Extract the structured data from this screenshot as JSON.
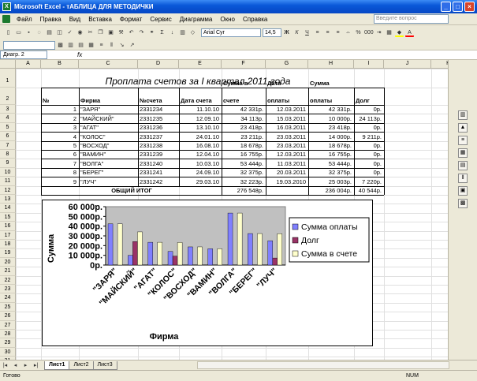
{
  "window": {
    "title": "Microsoft Excel - тАБЛИЦА ДЛЯ МЕТОДИЧКИ",
    "app_icon": "excel-icon"
  },
  "menu": {
    "items": [
      "Файл",
      "Правка",
      "Вид",
      "Вставка",
      "Формат",
      "Сервис",
      "Диаграмма",
      "Окно",
      "Справка"
    ],
    "help_placeholder": "Введите вопрос"
  },
  "toolbar": {
    "font": "Arial Cyr",
    "size": "14,5"
  },
  "namebox": "Диагр. 2",
  "fx": "fx",
  "columns": [
    "A",
    "B",
    "C",
    "D",
    "E",
    "F",
    "G",
    "H",
    "I",
    "J",
    "K"
  ],
  "rows": [
    "1",
    "2",
    "3",
    "4",
    "5",
    "6",
    "7",
    "8",
    "9",
    "10",
    "11",
    "12",
    "13",
    "14",
    "15",
    "16",
    "17",
    "18",
    "19",
    "20",
    "21",
    "22",
    "23",
    "24",
    "25",
    "26",
    "27",
    "28",
    "29",
    "30",
    "31"
  ],
  "sheet": {
    "title": "Проплата счетов за I квартал 2011 года",
    "headers": {
      "num": "№",
      "firm": "Фирма",
      "invoice": "№счета",
      "inv_date": "Дата счета",
      "sum_line1": "Сумма в",
      "sum_line2": "счете",
      "pay_line1": "Дата",
      "pay_line2": "оплаты",
      "paid_line1": "Сумма",
      "paid_line2": "оплаты",
      "debt": "Долг"
    },
    "data": [
      [
        "1",
        "\"ЗАРЯ\"",
        "2331234",
        "11.10.10",
        "42 331р.",
        "12.03.2011",
        "42 331р.",
        "0р."
      ],
      [
        "2",
        "\"МАЙСКИЙ\"",
        "2331235",
        "12.09.10",
        "34 113р.",
        "15.03.2011",
        "10 000р.",
        "24 113р."
      ],
      [
        "3",
        "\"АГАТ\"",
        "2331236",
        "13.10.10",
        "23 418р.",
        "16.03.2011",
        "23 418р.",
        "0р."
      ],
      [
        "4",
        "\"КОЛОС\"",
        "2331237",
        "24.01.10",
        "23 211р.",
        "23.03.2011",
        "14 000р.",
        "9 211р."
      ],
      [
        "5",
        "\"ВОСХОД\"",
        "2331238",
        "16.08.10",
        "18 678р.",
        "23.03.2011",
        "18 678р.",
        "0р."
      ],
      [
        "6",
        "\"ВАМИН\"",
        "2331239",
        "12.04.10",
        "16 755р.",
        "12.03.2011",
        "16 755р.",
        "0р."
      ],
      [
        "7",
        "\"ВОЛГА\"",
        "2331240",
        "10.03.10",
        "53 444р.",
        "11.03.2011",
        "53 444р.",
        "0р."
      ],
      [
        "8",
        "\"БЕРЕГ\"",
        "2331241",
        "24.09.10",
        "32 375р.",
        "20.03.2011",
        "32 375р.",
        "0р."
      ],
      [
        "9",
        "\"ЛУЧ\"",
        "2331242",
        "29.03.10",
        "32 223р.",
        "19.03.2010",
        "25 003р.",
        "7 220р."
      ]
    ],
    "total": {
      "label": "ОБЩИЙ ИТОГ",
      "sum": "276 548р.",
      "paid": "236 004р.",
      "debt": "40 544р."
    }
  },
  "chart_data": {
    "type": "bar",
    "categories": [
      "\"ЗАРЯ\"",
      "\"МАЙСКИЙ\"",
      "\"АГАТ\"",
      "\"КОЛОС\"",
      "\"ВОСХОД\"",
      "\"ВАМИН\"",
      "\"ВОЛГА\"",
      "\"БЕРЕГ\"",
      "\"ЛУЧ\""
    ],
    "series": [
      {
        "name": "Сумма оплаты",
        "values": [
          42331,
          10000,
          23418,
          14000,
          18678,
          16755,
          53444,
          32375,
          25003
        ],
        "color": "#8080ff"
      },
      {
        "name": "Долг",
        "values": [
          0,
          24113,
          0,
          9211,
          0,
          0,
          0,
          0,
          7220
        ],
        "color": "#993366"
      },
      {
        "name": "Сумма в счете",
        "values": [
          42331,
          34113,
          23418,
          23211,
          18678,
          16755,
          53444,
          32375,
          32223
        ],
        "color": "#ffffcc"
      }
    ],
    "yticks": [
      "0р.",
      "10 000р.",
      "20 000р.",
      "30 000р.",
      "40 000р.",
      "50 000р.",
      "60 000р."
    ],
    "ylim": [
      0,
      60000
    ],
    "xlabel": "Фирма",
    "ylabel": "Сумма",
    "legend": "right",
    "grid": false,
    "plot_bg": "#c0c0c0"
  },
  "tabs": [
    "Лист1",
    "Лист2",
    "Лист3"
  ],
  "status": {
    "left": "Готово",
    "num": "NUM"
  }
}
